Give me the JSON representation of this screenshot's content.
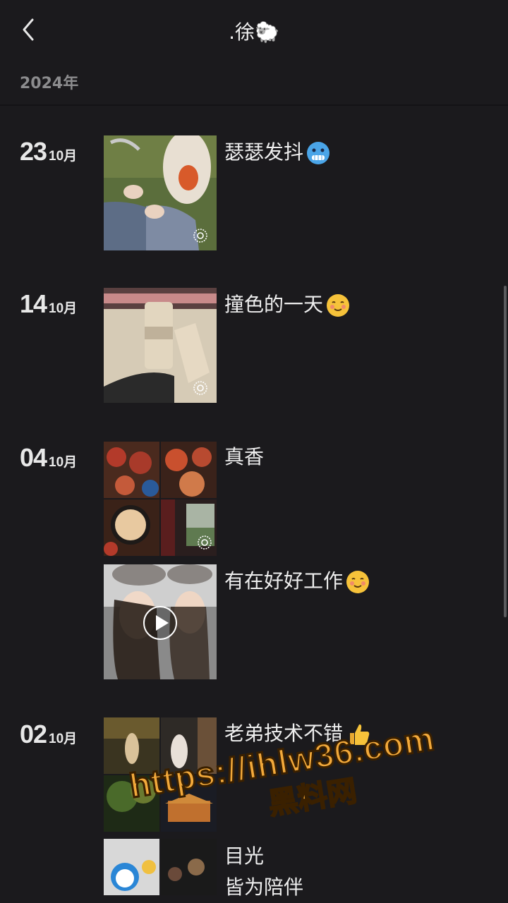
{
  "header": {
    "title": ".徐🐑",
    "year": "2024年"
  },
  "entries": [
    {
      "day": "23",
      "month": "10月",
      "caption": "瑟瑟发抖",
      "emoji": "freezing-face"
    },
    {
      "day": "14",
      "month": "10月",
      "caption": "撞色的一天",
      "emoji": "smiling-face"
    },
    {
      "day": "04",
      "month": "10月",
      "caption": "真香",
      "caption2": "有在好好工作",
      "emoji2": "smiling-face"
    },
    {
      "day": "02",
      "month": "10月",
      "caption": "老弟技术不错",
      "emoji": "thumbs-up",
      "caption2": "目光",
      "caption3": "皆为陪伴"
    }
  ],
  "watermark": {
    "line1": "https://ihlw36.com",
    "line2": "黑料网"
  },
  "colors": {
    "background": "#1b1a1d",
    "text": "#ececec",
    "muted": "#8c8c8e",
    "watermark": "#f2a93b"
  }
}
